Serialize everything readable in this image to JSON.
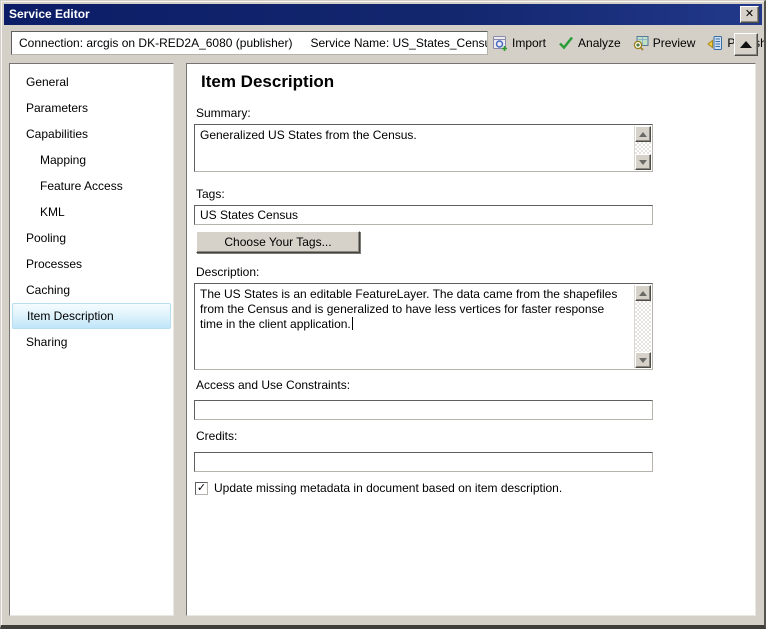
{
  "window": {
    "title": "Service Editor"
  },
  "icons": {
    "close_glyph": "✕",
    "check_glyph": "✓"
  },
  "toolbar": {
    "connection": "Connection: arcgis on DK-RED2A_6080 (publisher)",
    "service_name": "Service Name: US_States_Census",
    "buttons": [
      {
        "label": "Import",
        "icon": "import-icon"
      },
      {
        "label": "Analyze",
        "icon": "analyze-icon"
      },
      {
        "label": "Preview",
        "icon": "preview-icon"
      },
      {
        "label": "Publish",
        "icon": "publish-icon"
      }
    ]
  },
  "sidebar": {
    "items": [
      {
        "label": "General",
        "sub": false,
        "selected": false
      },
      {
        "label": "Parameters",
        "sub": false,
        "selected": false
      },
      {
        "label": "Capabilities",
        "sub": false,
        "selected": false
      },
      {
        "label": "Mapping",
        "sub": true,
        "selected": false
      },
      {
        "label": "Feature Access",
        "sub": true,
        "selected": false
      },
      {
        "label": "KML",
        "sub": true,
        "selected": false
      },
      {
        "label": "Pooling",
        "sub": false,
        "selected": false
      },
      {
        "label": "Processes",
        "sub": false,
        "selected": false
      },
      {
        "label": "Caching",
        "sub": false,
        "selected": false
      },
      {
        "label": "Item Description",
        "sub": false,
        "selected": true
      },
      {
        "label": "Sharing",
        "sub": false,
        "selected": false
      }
    ]
  },
  "main": {
    "heading": "Item Description",
    "summary": {
      "label": "Summary:",
      "value": "Generalized US States from the Census."
    },
    "tags": {
      "label": "Tags:",
      "value": "US States Census"
    },
    "choose_tags_button": "Choose Your Tags...",
    "description": {
      "label": "Description:",
      "value": "The US States is an editable FeatureLayer. The data came from the shapefiles from the Census and is generalized to have less vertices for faster response time in the client application."
    },
    "access": {
      "label": "Access and Use Constraints:",
      "value": ""
    },
    "credits": {
      "label": "Credits:",
      "value": ""
    },
    "update_checkbox": {
      "label": "Update missing metadata in document based on item description.",
      "checked": true
    }
  },
  "colors": {
    "titlebar": "#0d1f69",
    "selection_top": "#f1fafe",
    "selection_bottom": "#c0e5f9",
    "analyze_green": "#2e9e3a"
  }
}
